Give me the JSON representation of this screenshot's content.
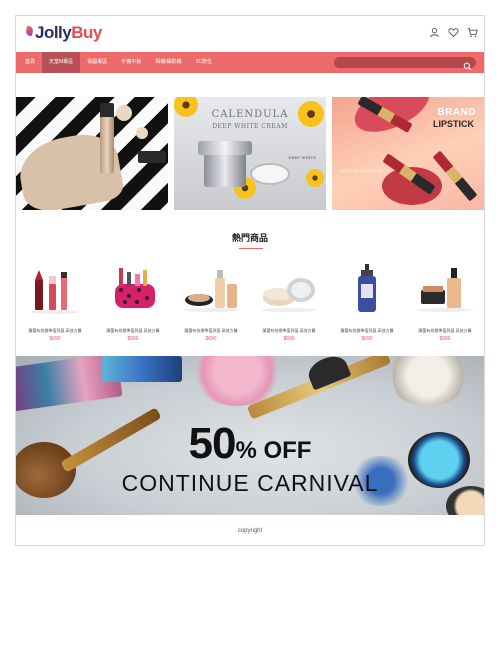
{
  "brand": {
    "jolly": "Jolly",
    "buy": "Buy"
  },
  "header_icons": [
    "user-icon",
    "heart-icon",
    "cart-icon"
  ],
  "nav": {
    "items": [
      {
        "label": "首頁",
        "active": false
      },
      {
        "label": "天堂M專區",
        "active": true
      },
      {
        "label": "電腦專區",
        "active": false
      },
      {
        "label": "手機平板",
        "active": false
      },
      {
        "label": "相機/攝影機",
        "active": false
      },
      {
        "label": "3C數位",
        "active": false
      }
    ],
    "search_placeholder": ""
  },
  "banners": [
    {
      "text": ""
    },
    {
      "title": "CALENDULA",
      "subtitle": "DEEP WHITE CREAM",
      "tag": "DEEP WHITE"
    },
    {
      "brand": "BRAND",
      "product": "LIPSTICK",
      "note": "LONG-LASTING LIPSTICK"
    }
  ],
  "section": {
    "title": "熱門商品"
  },
  "products": [
    {
      "name": "蘭蕾有效標準值到菌-高效方醫",
      "price": "$690",
      "kind": "lipstick"
    },
    {
      "name": "蘭蕾有效標準值到菌-高效方醫",
      "price": "$690",
      "kind": "pouch"
    },
    {
      "name": "蘭蕾有效標準值到菌-高效方醫",
      "price": "$690",
      "kind": "compact"
    },
    {
      "name": "蘭蕾有效標準值到菌-高效方醫",
      "price": "$690",
      "kind": "cream"
    },
    {
      "name": "蘭蕾有效標準值到菌-高效方醫",
      "price": "$690",
      "kind": "bottle"
    },
    {
      "name": "蘭蕾有效標準值到菌-高效方醫",
      "price": "$690",
      "kind": "foundation"
    }
  ],
  "promo": {
    "percent": "50",
    "off": "% OFF",
    "subtitle": "CONTINUE  CARNIVAL"
  },
  "footer": {
    "text": "copyright"
  },
  "colors": {
    "nav_bg": "#ee6a6a",
    "nav_active": "#b85055",
    "search_bg": "#b4484e",
    "price": "#e0555f",
    "brand_dark": "#2a2f63",
    "brand_red": "#e64a52"
  }
}
